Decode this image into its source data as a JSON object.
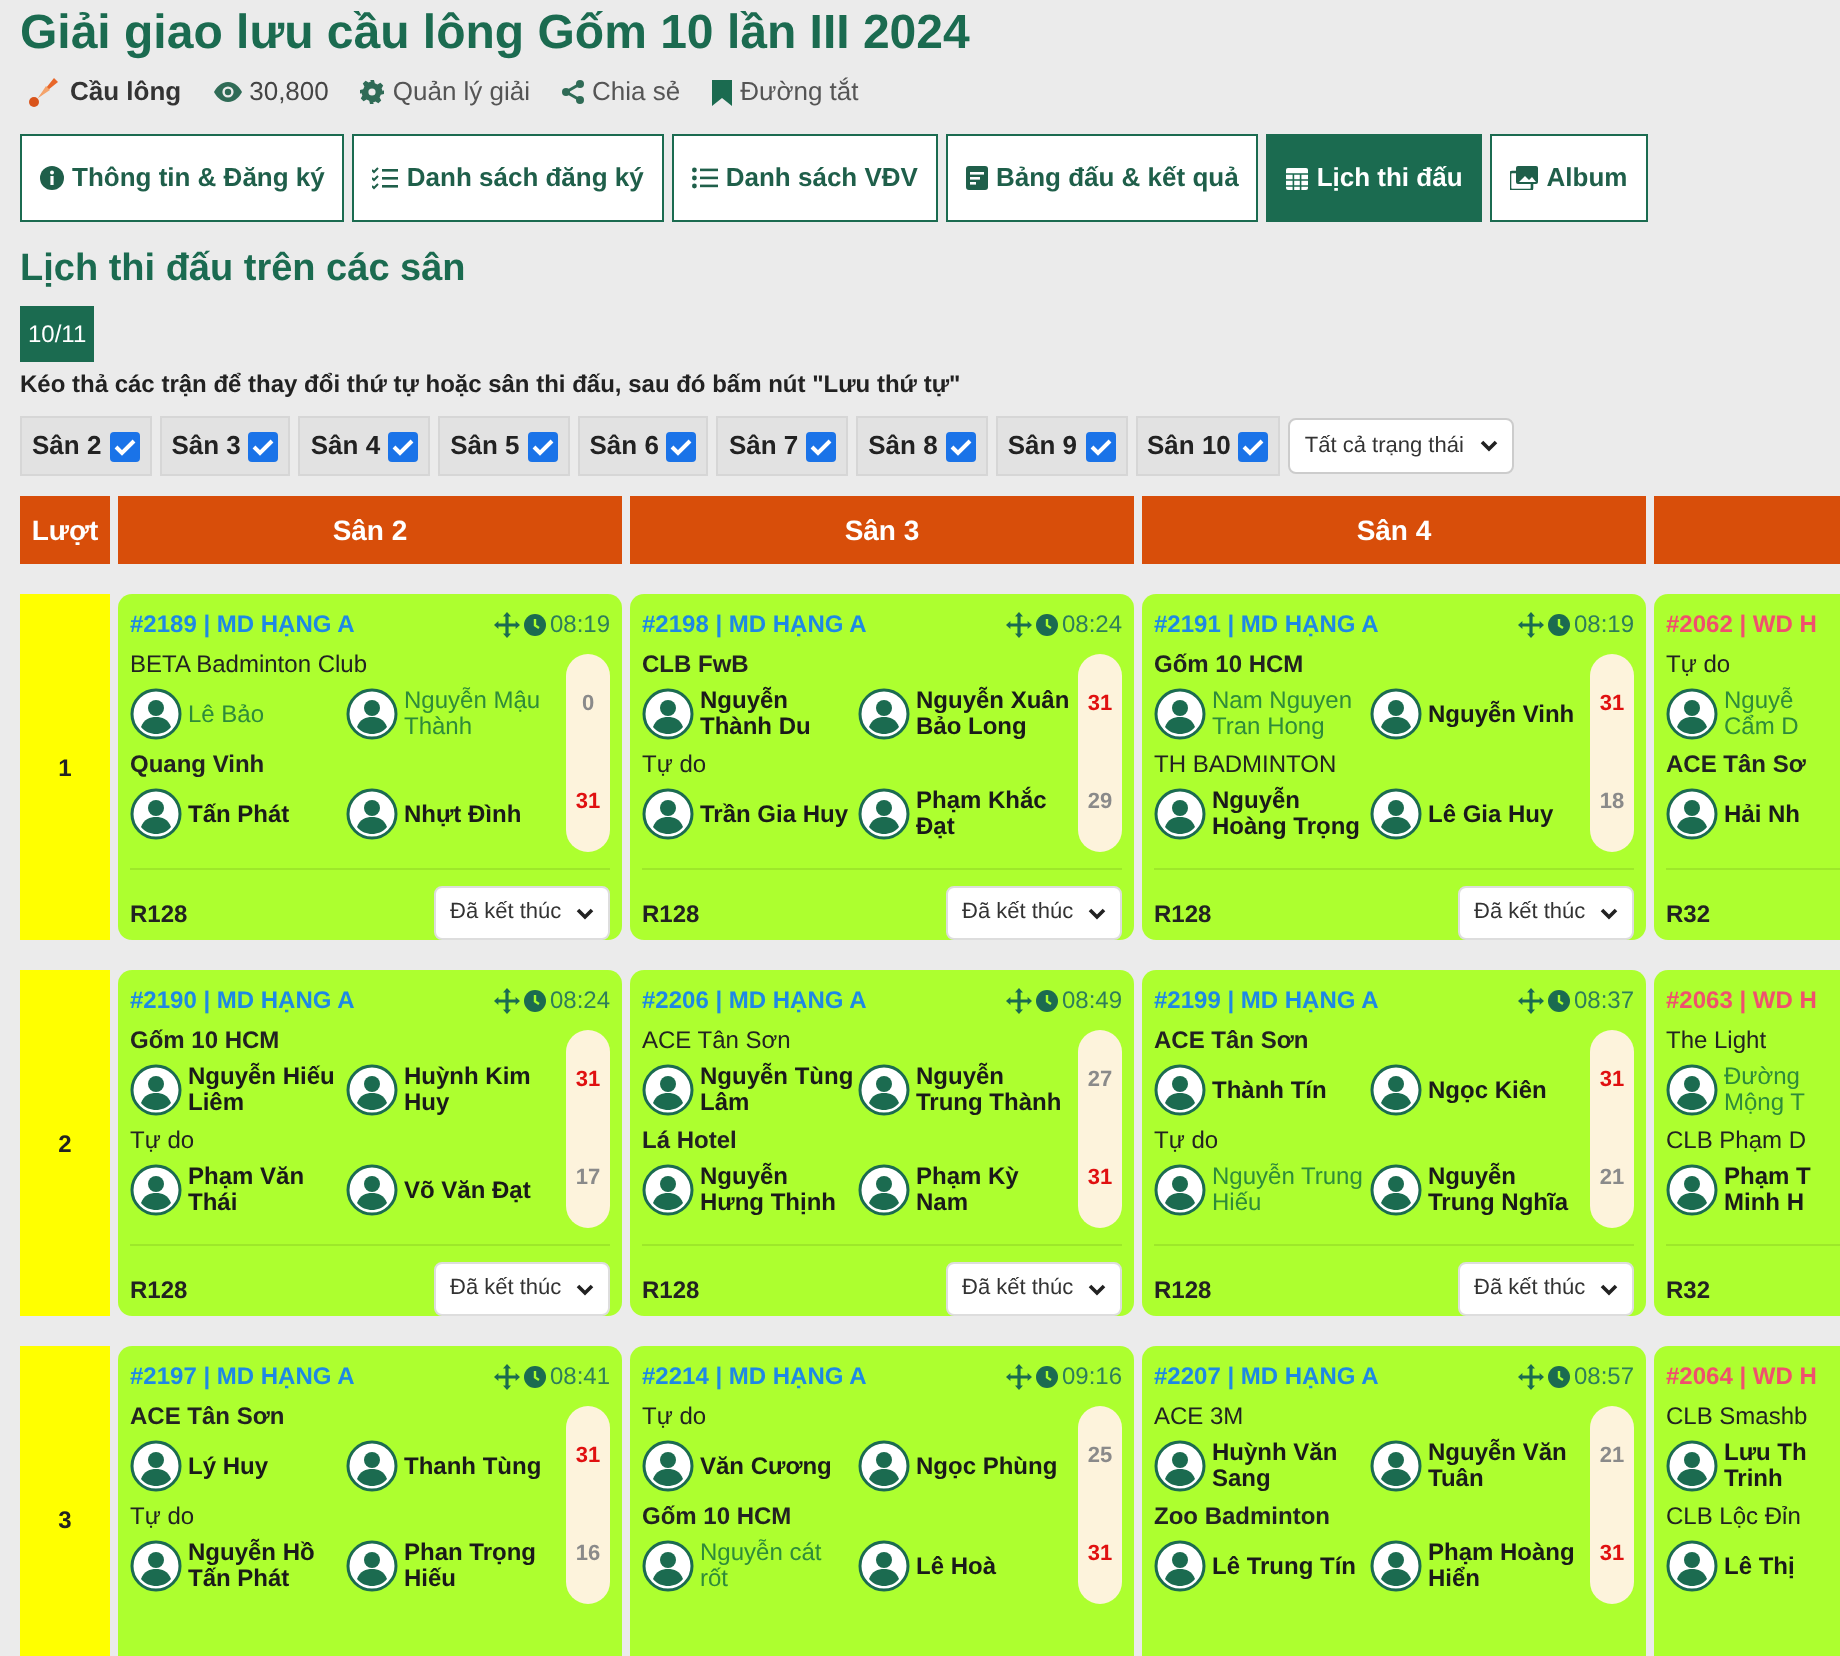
{
  "title": "Giải giao lưu cầu lông Gốm 10 lần III 2024",
  "meta": {
    "sport": "Cầu lông",
    "views": "30,800",
    "links": [
      "Quản lý giải",
      "Chia sẻ",
      "Đường tắt"
    ]
  },
  "tabs": [
    {
      "label": "Thông tin & Đăng ký",
      "selected": false
    },
    {
      "label": "Danh sách đăng ký",
      "selected": false
    },
    {
      "label": "Danh sách VĐV",
      "selected": false
    },
    {
      "label": "Bảng đấu & kết quả",
      "selected": false
    },
    {
      "label": "Lịch thi đấu",
      "selected": true
    },
    {
      "label": "Album",
      "selected": false
    }
  ],
  "section_title": "Lịch thi đấu trên các sân",
  "date_badge": "10/11",
  "instruction": "Kéo thả các trận để thay đổi thứ tự hoặc sân thi đấu, sau đó bấm nút \"Lưu thứ tự\"",
  "court_filters": [
    {
      "label": "Sân 2",
      "checked": true
    },
    {
      "label": "Sân 3",
      "checked": true
    },
    {
      "label": "Sân 4",
      "checked": true
    },
    {
      "label": "Sân 5",
      "checked": true
    },
    {
      "label": "Sân 6",
      "checked": true
    },
    {
      "label": "Sân 7",
      "checked": true
    },
    {
      "label": "Sân 8",
      "checked": true
    },
    {
      "label": "Sân 9",
      "checked": true
    },
    {
      "label": "Sân 10",
      "checked": true
    }
  ],
  "status_filter": {
    "value": "Tất cả trạng thái"
  },
  "schedule": {
    "round_header": "Lượt",
    "courts": [
      {
        "label": "Sân 2"
      },
      {
        "label": "Sân 3"
      },
      {
        "label": "Sân 4"
      }
    ],
    "rounds": [
      {
        "label": "1",
        "matches": [
          {
            "code": "#2189 | MD HẠNG A",
            "color": "#1e88e5",
            "time": "08:19",
            "stage": "R128",
            "status": "Đã kết thúc",
            "teams": [
              {
                "name": "BETA Badminton Club",
                "winner": false,
                "score": "0",
                "players": [
                  {
                    "name": "Lê Bảo",
                    "highlighted": true
                  },
                  {
                    "name": "Nguyễn Mậu Thành",
                    "highlighted": true
                  }
                ]
              },
              {
                "name": "Quang Vinh",
                "winner": true,
                "score": "31",
                "players": [
                  {
                    "name": "Tấn Phát",
                    "highlighted": false
                  },
                  {
                    "name": "Nhựt Đình",
                    "highlighted": false
                  }
                ]
              }
            ]
          },
          {
            "code": "#2198 | MD HẠNG A",
            "color": "#1e88e5",
            "time": "08:24",
            "stage": "R128",
            "status": "Đã kết thúc",
            "teams": [
              {
                "name": "CLB FwB",
                "winner": true,
                "score": "31",
                "players": [
                  {
                    "name": "Nguyễn Thành Du",
                    "highlighted": false
                  },
                  {
                    "name": "Nguyễn Xuân Bảo Long",
                    "highlighted": false
                  }
                ]
              },
              {
                "name": "Tự do",
                "winner": false,
                "score": "29",
                "players": [
                  {
                    "name": "Trần Gia Huy",
                    "highlighted": false
                  },
                  {
                    "name": "Phạm Khắc Đạt",
                    "highlighted": false
                  }
                ]
              }
            ]
          },
          {
            "code": "#2191 | MD HẠNG A",
            "color": "#1e88e5",
            "time": "08:19",
            "stage": "R128",
            "status": "Đã kết thúc",
            "teams": [
              {
                "name": "Gốm 10 HCM",
                "winner": true,
                "score": "31",
                "players": [
                  {
                    "name": "Nam Nguyen Tran Hong",
                    "highlighted": true
                  },
                  {
                    "name": "Nguyễn Vinh",
                    "highlighted": false
                  }
                ]
              },
              {
                "name": "TH BADMINTON",
                "winner": false,
                "score": "18",
                "players": [
                  {
                    "name": "Nguyễn Hoàng Trọng",
                    "highlighted": false
                  },
                  {
                    "name": "Lê Gia Huy",
                    "highlighted": false
                  }
                ]
              }
            ]
          },
          {
            "code": "#2062 | WD H",
            "color": "#f0506e",
            "stage": "R32",
            "teams": [
              {
                "name": "Tự do",
                "winner": false,
                "players": [
                  {
                    "name": "Nguyễ\nCẩm D",
                    "highlighted": true
                  }
                ]
              },
              {
                "name": "ACE Tân Sơ",
                "winner": true,
                "players": [
                  {
                    "name": "Hải Nh",
                    "highlighted": false
                  }
                ]
              }
            ]
          }
        ]
      },
      {
        "label": "2",
        "matches": [
          {
            "code": "#2190 | MD HẠNG A",
            "color": "#1e88e5",
            "time": "08:24",
            "stage": "R128",
            "status": "Đã kết thúc",
            "teams": [
              {
                "name": "Gốm 10 HCM",
                "winner": true,
                "score": "31",
                "players": [
                  {
                    "name": "Nguyễn Hiếu Liêm",
                    "highlighted": false
                  },
                  {
                    "name": "Huỳnh Kim Huy",
                    "highlighted": false
                  }
                ]
              },
              {
                "name": "Tự do",
                "winner": false,
                "score": "17",
                "players": [
                  {
                    "name": "Phạm Văn Thái",
                    "highlighted": false
                  },
                  {
                    "name": "Võ Văn Đạt",
                    "highlighted": false
                  }
                ]
              }
            ]
          },
          {
            "code": "#2206 | MD HẠNG A",
            "color": "#1e88e5",
            "time": "08:49",
            "stage": "R128",
            "status": "Đã kết thúc",
            "teams": [
              {
                "name": "ACE Tân Sơn",
                "winner": false,
                "score": "27",
                "players": [
                  {
                    "name": "Nguyễn Tùng Lâm",
                    "highlighted": false
                  },
                  {
                    "name": "Nguyễn Trung Thành",
                    "highlighted": false
                  }
                ]
              },
              {
                "name": "Lá Hotel",
                "winner": true,
                "score": "31",
                "players": [
                  {
                    "name": "Nguyễn Hưng Thịnh",
                    "highlighted": false
                  },
                  {
                    "name": "Phạm Kỳ Nam",
                    "highlighted": false
                  }
                ]
              }
            ]
          },
          {
            "code": "#2199 | MD HẠNG A",
            "color": "#1e88e5",
            "time": "08:37",
            "stage": "R128",
            "status": "Đã kết thúc",
            "teams": [
              {
                "name": "ACE Tân Sơn",
                "winner": true,
                "score": "31",
                "players": [
                  {
                    "name": "Thành Tín",
                    "highlighted": false
                  },
                  {
                    "name": "Ngọc Kiên",
                    "highlighted": false
                  }
                ]
              },
              {
                "name": "Tự do",
                "winner": false,
                "score": "21",
                "players": [
                  {
                    "name": "Nguyễn Trung Hiếu",
                    "highlighted": true
                  },
                  {
                    "name": "Nguyễn Trung Nghĩa",
                    "highlighted": false
                  }
                ]
              }
            ]
          },
          {
            "code": "#2063 | WD H",
            "color": "#f0506e",
            "stage": "R32",
            "teams": [
              {
                "name": "The Light",
                "winner": false,
                "players": [
                  {
                    "name": "Đường\nMộng T",
                    "highlighted": true
                  }
                ]
              },
              {
                "name": "CLB Phạm D",
                "winner": false,
                "players": [
                  {
                    "name": "Phạm T\nMinh H",
                    "highlighted": false
                  }
                ]
              }
            ]
          }
        ]
      },
      {
        "label": "3",
        "matches": [
          {
            "code": "#2197 | MD HẠNG A",
            "color": "#1e88e5",
            "time": "08:41",
            "teams": [
              {
                "name": "ACE Tân Sơn",
                "winner": true,
                "score": "31",
                "players": [
                  {
                    "name": "Lý Huy",
                    "highlighted": false
                  },
                  {
                    "name": "Thanh Tùng",
                    "highlighted": false
                  }
                ]
              },
              {
                "name": "Tự do",
                "winner": false,
                "score": "16",
                "players": [
                  {
                    "name": "Nguyễn Hồ Tấn Phát",
                    "highlighted": false
                  },
                  {
                    "name": "Phan Trọng Hiếu",
                    "highlighted": false
                  }
                ]
              }
            ]
          },
          {
            "code": "#2214 | MD HẠNG A",
            "color": "#1e88e5",
            "time": "09:16",
            "teams": [
              {
                "name": "Tự do",
                "winner": false,
                "score": "25",
                "players": [
                  {
                    "name": "Văn Cương",
                    "highlighted": false
                  },
                  {
                    "name": "Ngọc Phùng",
                    "highlighted": false
                  }
                ]
              },
              {
                "name": "Gốm 10 HCM",
                "winner": true,
                "score": "31",
                "players": [
                  {
                    "name": "Nguyễn cát rốt",
                    "highlighted": true
                  },
                  {
                    "name": "Lê Hoà",
                    "highlighted": false
                  }
                ]
              }
            ]
          },
          {
            "code": "#2207 | MD HẠNG A",
            "color": "#1e88e5",
            "time": "08:57",
            "teams": [
              {
                "name": "ACE 3M",
                "winner": false,
                "score": "21",
                "players": [
                  {
                    "name": "Huỳnh Văn Sang",
                    "highlighted": false
                  },
                  {
                    "name": "Nguyễn Văn Tuân",
                    "highlighted": false
                  }
                ]
              },
              {
                "name": "Zoo Badminton",
                "winner": true,
                "score": "31",
                "players": [
                  {
                    "name": "Lê Trung Tín",
                    "highlighted": false
                  },
                  {
                    "name": "Phạm Hoàng Hiển",
                    "highlighted": false
                  }
                ]
              }
            ]
          },
          {
            "code": "#2064 | WD H",
            "color": "#f0506e",
            "teams": [
              {
                "name": "CLB Smashb",
                "winner": false,
                "players": [
                  {
                    "name": "Lưu Th\nTrinh",
                    "highlighted": false
                  }
                ]
              },
              {
                "name": "CLB Lộc Đỉn",
                "winner": false,
                "players": [
                  {
                    "name": "Lê Thị",
                    "highlighted": false
                  }
                ]
              }
            ]
          }
        ]
      }
    ]
  }
}
